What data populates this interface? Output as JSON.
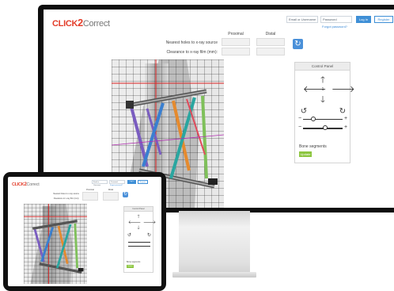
{
  "app": {
    "logo_part1": "CLICK",
    "logo_part2": "2",
    "logo_part3": "Correct"
  },
  "header": {
    "email_placeholder": "Email or Username",
    "password_placeholder": "Password",
    "login_label": "Log In",
    "register_label": "Register",
    "forgot_password": "Forgot password?"
  },
  "form": {
    "col_proximal": "Proximal",
    "col_distal": "Distal",
    "row1_label": "Nearest holes to x-ray source",
    "row2_label": "Clearance to x-ray film (mm):",
    "refresh_icon": "refresh-icon"
  },
  "control_panel": {
    "title": "Control Panel",
    "icons": [
      "arrow-up-icon",
      "arrow-left-icon",
      "arrow-right-icon",
      "arrow-down-icon",
      "rotate-ccw-icon",
      "rotate-cw-icon",
      "minus-icon",
      "plus-icon"
    ],
    "center_value": "1",
    "slider1_fraction": 0.25,
    "slider2_fraction": 0.55,
    "bone_segments_label": "Bone segments",
    "update_label": "Update"
  },
  "colors": {
    "brand_red": "#e33d2a",
    "accent_blue": "#4a90d9",
    "update_green": "#8cc63f"
  }
}
